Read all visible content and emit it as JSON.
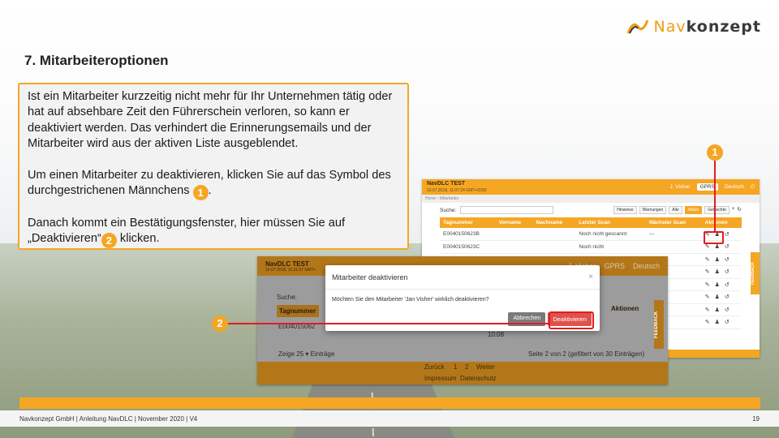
{
  "logo": {
    "part1": "Nav",
    "part2": "konzept"
  },
  "title": "7. Mitarbeiteroptionen",
  "text": {
    "p1": "Ist ein Mitarbeiter kurzzeitig nicht mehr für Ihr Unternehmen tätig oder hat auf absehbare Zeit den Führerschein verloren, so kann er deaktiviert werden. Das verhindert die Erinnerungsemails und der Mitarbeiter wird aus der aktiven Liste ausgeblendet.",
    "p2_a": "Um einen Mitarbeiter zu deaktivieren, klicken Sie auf das Symbol des durchgestrichenen Männchens",
    "p2_b": ".",
    "p3_a": "Danach kommt ein Bestätigungsfenster, hier müssen Sie auf „Deaktivieren“",
    "p3_b": " klicken.",
    "badge1": "1",
    "badge2": "2"
  },
  "shot1": {
    "brand": "NavDLC TEST",
    "brand_sub": "10.07.2018, 11:07:24 GMT+0200",
    "user": "J. Visher",
    "select": "GPRS",
    "lang": "Deutsch",
    "search_label": "Suche:",
    "filter_buttons": [
      "Hinweise",
      "Warnungen",
      "Alle",
      "Aktive",
      "Gelöschte"
    ],
    "headers": [
      "Tagnummer",
      "Vorname",
      "Nachname",
      "Letzter Scan",
      "Nächster Scan",
      "Aktionen"
    ],
    "rows": [
      {
        "tag": "E0040150623B",
        "last": "Noch nicht gescannt",
        "next": "---"
      },
      {
        "tag": "E0040150623C",
        "last": "Noch nicht",
        "next": ""
      }
    ],
    "feedback": "FEEDBACK"
  },
  "shot2": {
    "brand": "NavDLC TEST",
    "brand_sub": "10.07.2018, 11:31:07 GMT+",
    "user": "J. Visher",
    "select": "GPRS",
    "lang": "Deutsch",
    "search_label": "Suche:",
    "col_header": "Tagnummer",
    "row_tag": "E004015062",
    "time": "10:08",
    "zeige": "Zeige",
    "entries": "25",
    "entries_label": "Einträge",
    "page_info": "Seite 2 von 2 (gefiltert von 30 Einträgen)",
    "prev": "Zurück",
    "page1": "1",
    "page2": "2",
    "next": "Weiter",
    "impressum": "Impressum",
    "datenschutz": "Datenschutz",
    "aktionen": "Aktionen",
    "feedback": "FEEDBACK"
  },
  "modal": {
    "title": "Mitarbeiter deaktivieren",
    "close": "×",
    "message": "Möchten Sie den Mitarbeiter 'Jan Visher' wirklich deaktivieren?",
    "cancel": "Abbrechen",
    "confirm": "Deaktivieren"
  },
  "footer": {
    "left": "Navkonzept GmbH  |  Anleitung NavDLC  |  November 2020  |  V4",
    "page": "19"
  },
  "colors": {
    "accent": "#f5a623",
    "highlight": "#e41c1c"
  }
}
